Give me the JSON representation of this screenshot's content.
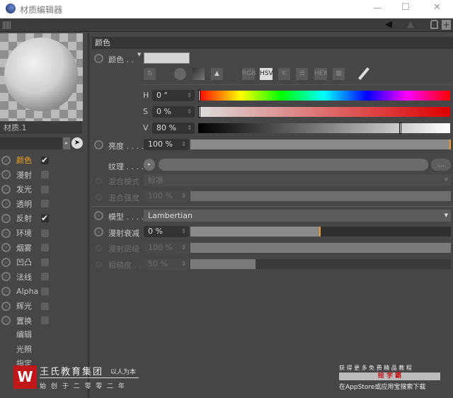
{
  "window": {
    "title": "材质编辑器",
    "minimize": "—",
    "maximize": "☐",
    "close": "✕"
  },
  "material": {
    "name": "材质.1"
  },
  "channels": [
    {
      "label": "颜色",
      "checked": true,
      "active": true
    },
    {
      "label": "漫射",
      "checked": false
    },
    {
      "label": "发光",
      "checked": false
    },
    {
      "label": "透明",
      "checked": false
    },
    {
      "label": "反射",
      "checked": true
    },
    {
      "label": "环境",
      "checked": false
    },
    {
      "label": "烟雾",
      "checked": false
    },
    {
      "label": "凹凸",
      "checked": false
    },
    {
      "label": "法线",
      "checked": false
    },
    {
      "label": "Alpha",
      "checked": false
    },
    {
      "label": "辉光",
      "checked": false
    },
    {
      "label": "置换",
      "checked": false
    }
  ],
  "extra_items": [
    "编辑",
    "光照",
    "指定"
  ],
  "section": {
    "title": "颜色"
  },
  "color": {
    "label": "颜色 . .",
    "swatch": "#d6d6d6",
    "modes": [
      "RGB",
      "HSV",
      "K",
      "HEX"
    ],
    "active_mode": "HSV",
    "h": {
      "label": "H",
      "value": "0 °",
      "fraction": 0
    },
    "s": {
      "label": "S",
      "value": "0 %",
      "fraction": 0
    },
    "v": {
      "label": "V",
      "value": "80 %",
      "fraction": 0.8
    }
  },
  "brightness": {
    "label": "亮度 . . . .",
    "value": "100 %",
    "fraction": 1
  },
  "texture": {
    "label": "纹理 . . . .",
    "more": "..."
  },
  "blend_mode": {
    "label": "混合模式",
    "value": "标准"
  },
  "blend_strength": {
    "label": "混合强度",
    "value": "100 %",
    "fraction": 1
  },
  "model": {
    "label": "模型 . . . .",
    "value": "Lambertian"
  },
  "diffuse_falloff": {
    "label": "漫射衰减",
    "value": "0 %",
    "fraction": 0.5
  },
  "diffuse_level": {
    "label": "漫射层级",
    "value": "100 %",
    "fraction": 1
  },
  "roughness": {
    "label": "粗糙度 . .",
    "value": "50 %",
    "fraction": 0.25
  },
  "watermark": {
    "company": "王氏教育集团",
    "slogan": "以人为本",
    "founded": "始 创 于 二 零 零 二 年",
    "promo1": "获 得 更 多 免 费 精 品 教 程",
    "brand": "绘 学 霸",
    "promo2": "在AppStore或应用宝搜索下载"
  },
  "accent": "#f0a020"
}
